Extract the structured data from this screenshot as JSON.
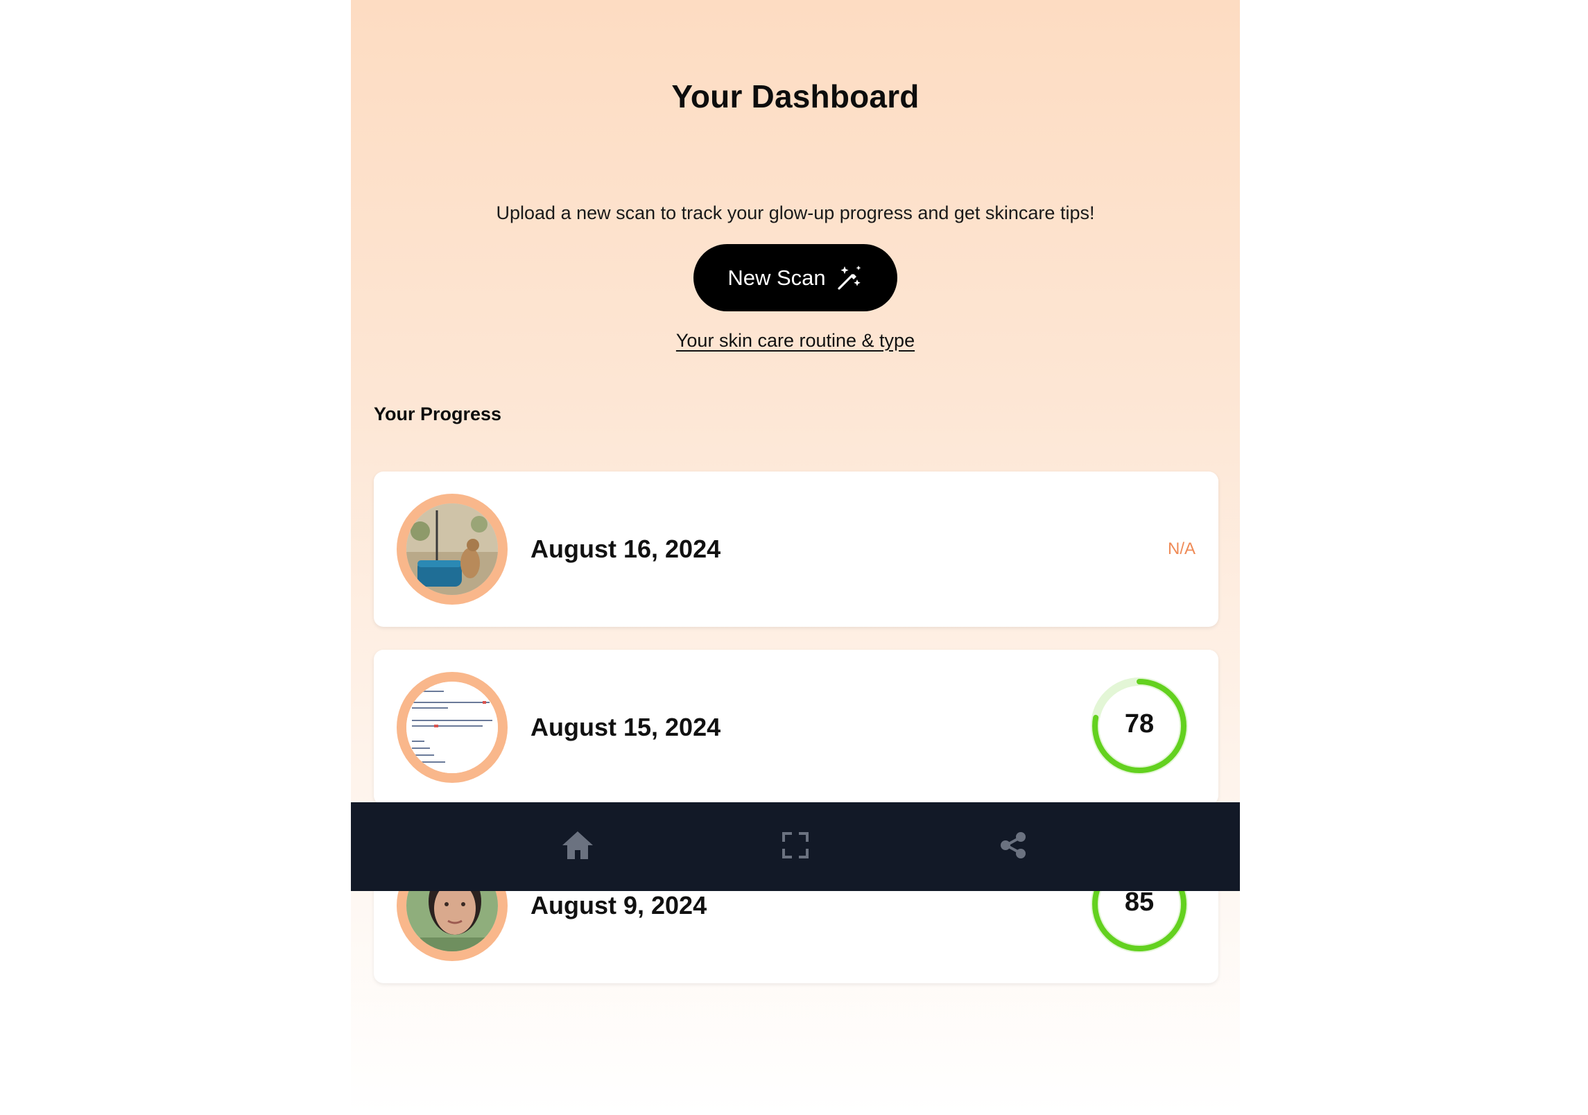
{
  "header": {
    "title": "Your Dashboard"
  },
  "hero": {
    "subtitle": "Upload a new scan to track your glow-up progress and get skincare tips!",
    "new_scan_label": "New Scan",
    "new_scan_icon": "magic-wand-icon",
    "routine_link": "Your skin care routine & type"
  },
  "progress": {
    "label": "Your Progress",
    "items": [
      {
        "date": "August 16, 2024",
        "score": "N/A",
        "thumbnail": "scan-photo-animal-outdoor"
      },
      {
        "date": "August 15, 2024",
        "score": "78",
        "score_fraction": 0.78,
        "thumbnail": "scan-photo-text-document"
      },
      {
        "date": "August 9, 2024",
        "score": "85",
        "score_fraction": 0.85,
        "thumbnail": "scan-photo-face"
      }
    ]
  },
  "bottom_nav": {
    "items": [
      {
        "icon": "home-icon"
      },
      {
        "icon": "scan-frame-icon"
      },
      {
        "icon": "share-icon"
      }
    ]
  },
  "colors": {
    "accent": "#f9b78b",
    "score_ring": "#63d11f",
    "score_ring_track": "#e3f6d6",
    "na_text": "#ef8b57",
    "nav_bg": "#121927",
    "nav_icon": "#6b7280"
  }
}
